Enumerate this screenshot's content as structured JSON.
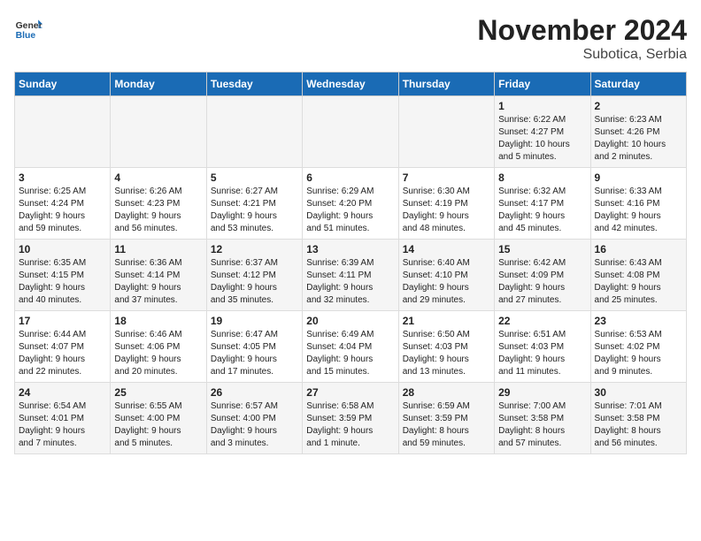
{
  "header": {
    "logo_line1": "General",
    "logo_line2": "Blue",
    "title": "November 2024",
    "subtitle": "Subotica, Serbia"
  },
  "days_of_week": [
    "Sunday",
    "Monday",
    "Tuesday",
    "Wednesday",
    "Thursday",
    "Friday",
    "Saturday"
  ],
  "weeks": [
    [
      {
        "day": "",
        "info": ""
      },
      {
        "day": "",
        "info": ""
      },
      {
        "day": "",
        "info": ""
      },
      {
        "day": "",
        "info": ""
      },
      {
        "day": "",
        "info": ""
      },
      {
        "day": "1",
        "info": "Sunrise: 6:22 AM\nSunset: 4:27 PM\nDaylight: 10 hours\nand 5 minutes."
      },
      {
        "day": "2",
        "info": "Sunrise: 6:23 AM\nSunset: 4:26 PM\nDaylight: 10 hours\nand 2 minutes."
      }
    ],
    [
      {
        "day": "3",
        "info": "Sunrise: 6:25 AM\nSunset: 4:24 PM\nDaylight: 9 hours\nand 59 minutes."
      },
      {
        "day": "4",
        "info": "Sunrise: 6:26 AM\nSunset: 4:23 PM\nDaylight: 9 hours\nand 56 minutes."
      },
      {
        "day": "5",
        "info": "Sunrise: 6:27 AM\nSunset: 4:21 PM\nDaylight: 9 hours\nand 53 minutes."
      },
      {
        "day": "6",
        "info": "Sunrise: 6:29 AM\nSunset: 4:20 PM\nDaylight: 9 hours\nand 51 minutes."
      },
      {
        "day": "7",
        "info": "Sunrise: 6:30 AM\nSunset: 4:19 PM\nDaylight: 9 hours\nand 48 minutes."
      },
      {
        "day": "8",
        "info": "Sunrise: 6:32 AM\nSunset: 4:17 PM\nDaylight: 9 hours\nand 45 minutes."
      },
      {
        "day": "9",
        "info": "Sunrise: 6:33 AM\nSunset: 4:16 PM\nDaylight: 9 hours\nand 42 minutes."
      }
    ],
    [
      {
        "day": "10",
        "info": "Sunrise: 6:35 AM\nSunset: 4:15 PM\nDaylight: 9 hours\nand 40 minutes."
      },
      {
        "day": "11",
        "info": "Sunrise: 6:36 AM\nSunset: 4:14 PM\nDaylight: 9 hours\nand 37 minutes."
      },
      {
        "day": "12",
        "info": "Sunrise: 6:37 AM\nSunset: 4:12 PM\nDaylight: 9 hours\nand 35 minutes."
      },
      {
        "day": "13",
        "info": "Sunrise: 6:39 AM\nSunset: 4:11 PM\nDaylight: 9 hours\nand 32 minutes."
      },
      {
        "day": "14",
        "info": "Sunrise: 6:40 AM\nSunset: 4:10 PM\nDaylight: 9 hours\nand 29 minutes."
      },
      {
        "day": "15",
        "info": "Sunrise: 6:42 AM\nSunset: 4:09 PM\nDaylight: 9 hours\nand 27 minutes."
      },
      {
        "day": "16",
        "info": "Sunrise: 6:43 AM\nSunset: 4:08 PM\nDaylight: 9 hours\nand 25 minutes."
      }
    ],
    [
      {
        "day": "17",
        "info": "Sunrise: 6:44 AM\nSunset: 4:07 PM\nDaylight: 9 hours\nand 22 minutes."
      },
      {
        "day": "18",
        "info": "Sunrise: 6:46 AM\nSunset: 4:06 PM\nDaylight: 9 hours\nand 20 minutes."
      },
      {
        "day": "19",
        "info": "Sunrise: 6:47 AM\nSunset: 4:05 PM\nDaylight: 9 hours\nand 17 minutes."
      },
      {
        "day": "20",
        "info": "Sunrise: 6:49 AM\nSunset: 4:04 PM\nDaylight: 9 hours\nand 15 minutes."
      },
      {
        "day": "21",
        "info": "Sunrise: 6:50 AM\nSunset: 4:03 PM\nDaylight: 9 hours\nand 13 minutes."
      },
      {
        "day": "22",
        "info": "Sunrise: 6:51 AM\nSunset: 4:03 PM\nDaylight: 9 hours\nand 11 minutes."
      },
      {
        "day": "23",
        "info": "Sunrise: 6:53 AM\nSunset: 4:02 PM\nDaylight: 9 hours\nand 9 minutes."
      }
    ],
    [
      {
        "day": "24",
        "info": "Sunrise: 6:54 AM\nSunset: 4:01 PM\nDaylight: 9 hours\nand 7 minutes."
      },
      {
        "day": "25",
        "info": "Sunrise: 6:55 AM\nSunset: 4:00 PM\nDaylight: 9 hours\nand 5 minutes."
      },
      {
        "day": "26",
        "info": "Sunrise: 6:57 AM\nSunset: 4:00 PM\nDaylight: 9 hours\nand 3 minutes."
      },
      {
        "day": "27",
        "info": "Sunrise: 6:58 AM\nSunset: 3:59 PM\nDaylight: 9 hours\nand 1 minute."
      },
      {
        "day": "28",
        "info": "Sunrise: 6:59 AM\nSunset: 3:59 PM\nDaylight: 8 hours\nand 59 minutes."
      },
      {
        "day": "29",
        "info": "Sunrise: 7:00 AM\nSunset: 3:58 PM\nDaylight: 8 hours\nand 57 minutes."
      },
      {
        "day": "30",
        "info": "Sunrise: 7:01 AM\nSunset: 3:58 PM\nDaylight: 8 hours\nand 56 minutes."
      }
    ]
  ]
}
